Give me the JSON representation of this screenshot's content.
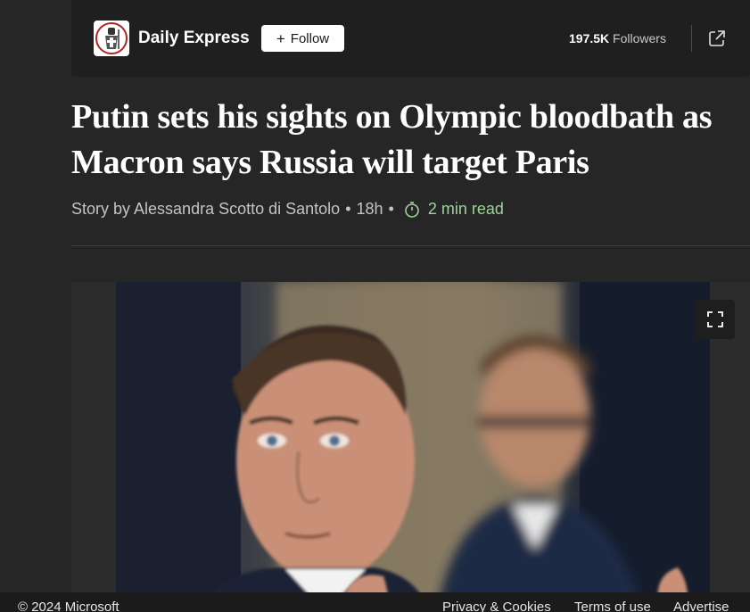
{
  "publisher": {
    "name": "Daily Express",
    "follow_label": "Follow",
    "follow_icon": "plus-icon",
    "followers_count": "197.5K",
    "followers_label": "Followers",
    "share_icon": "open-external-icon",
    "logo_icon": "crusader-knight-logo"
  },
  "article": {
    "headline": "Putin sets his sights on Olympic bloodbath as Macron says Russia will target Paris",
    "byline": "Story by Alessandra Scotto di Santolo",
    "age": "18h",
    "separator": "•",
    "read_time": "2 min read",
    "read_time_icon": "stopwatch-icon"
  },
  "media": {
    "expand_icon": "fullscreen-icon"
  },
  "footer": {
    "copyright": "© 2024 Microsoft",
    "links": [
      "Privacy & Cookies",
      "Terms of use",
      "Advertise"
    ]
  },
  "colors": {
    "background": "#262626",
    "header_bar": "#1f1f1f",
    "read_time": "#9fd29a",
    "byline": "#c4c4c4"
  }
}
